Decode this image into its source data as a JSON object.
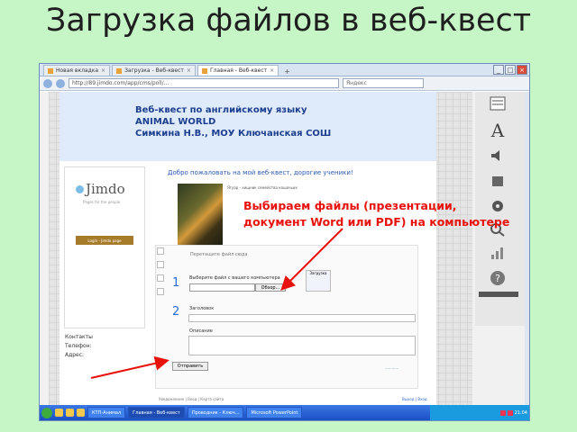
{
  "slide": {
    "title": "Загрузка файлов в веб-квест"
  },
  "browser": {
    "tabs": [
      {
        "label": "Новая вкладка"
      },
      {
        "label": "Загрузка - Веб-квест"
      },
      {
        "label": "Главная - Веб-квест"
      }
    ],
    "new_tab_label": "+",
    "url": "http://89.jimdo.com/app/cms/poll/...",
    "search_placeholder": "Яндекс"
  },
  "site": {
    "header_line1": "Веб-квест по английскому языку",
    "header_line2": "ANIMAL WORLD",
    "header_line3": "Симкина Н.В., МОУ Ключанская СОШ",
    "logo_text": "Jimdo",
    "logo_subtitle": "Pages for the people",
    "sidebar_button": "Login - Jimdo page",
    "contacts_heading": "Контакты",
    "contacts_phone": "Телефон:",
    "contacts_address": "Адрес:",
    "welcome": "Добро пожаловать на мой веб-квест, дорогие ученики!",
    "photo_caption": "Ягуар - хищник семейства кошачьих",
    "drop_label": "Перетащите файл сюда",
    "file_label": "Выберите файл с вашего компьютера",
    "browse_button": "Обзор...",
    "cloud_label": "Загрузка",
    "step1": "1",
    "step2": "2",
    "subject_label": "Заголовок",
    "comment_label": "Описание",
    "send_button": "Отправить",
    "small_link": "............",
    "footer_left": "Уведомление | Вход | Карта сайта",
    "footer_right": "Выход | Вход"
  },
  "annotation": {
    "line1": "Выбираем файлы (презентации,",
    "line2": "документ Word или PDF) на компьютере"
  },
  "taskbar": {
    "tasks": [
      {
        "label": "КТП-Анимал"
      },
      {
        "label": "Главная - Веб-квест"
      },
      {
        "label": "Проводник - Ключ..."
      },
      {
        "label": "Microsoft PowerPoint"
      }
    ],
    "clock": "21:04"
  },
  "colors": {
    "slide_background": "#c6f5c6",
    "annotation": "#e8120c",
    "site_header_text": "#1d3f8f",
    "step_number": "#2a6ad6"
  }
}
